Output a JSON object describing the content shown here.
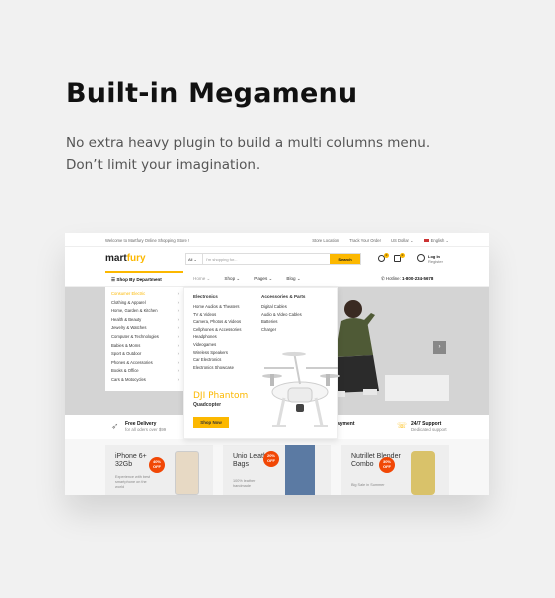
{
  "headline": "Built-in Megamenu",
  "description": [
    "No extra heavy plugin to build a multi columns menu.",
    "Don’t limit your imagination."
  ],
  "screenshot": {
    "topbar": {
      "welcome": "Welcome to Martfury Online Shopping Store !",
      "store_location": "Store Location",
      "track_order": "Track Your Order",
      "currency": "US Dollar ⌄",
      "language": "English ⌄"
    },
    "logo": {
      "part1": "mart",
      "part2": "fury"
    },
    "search": {
      "category": "All ⌄",
      "placeholder": "I'm shopping for...",
      "button": "Search"
    },
    "badges": {
      "wishlist": "0",
      "cart": "0"
    },
    "login": {
      "label": "Log In",
      "sub": "Register"
    },
    "nav": {
      "department": "Shop By Department",
      "links": [
        "Home ⌄",
        "Shop ⌄",
        "Pages ⌄",
        "Blog ⌄"
      ],
      "hotline_label": "Hotline:",
      "hotline_number": "1-800-234-5678"
    },
    "departments": [
      "Consumer Electric",
      "Clothing & Apparel",
      "Home, Garden & Kitchen",
      "Health & Beauty",
      "Jewelry & Watches",
      "Computer & Technologies",
      "Babies & Moms",
      "Sport & Outdoor",
      "Phones & Accessories",
      "Books & Office",
      "Cars & Motocycles"
    ],
    "megamenu": {
      "col1_title": "Electronics",
      "col1_links": [
        "Home Audios & Theaters",
        "TV & Videos",
        "Camera, Photos & Videos",
        "Cellphones & Accessories",
        "Headphones",
        "Videogames",
        "Wireless Speakers",
        "Car Electronics",
        "Electronics Showcase"
      ],
      "col2_title": "Accessories & Parts",
      "col2_links": [
        "Digital Cables",
        "Audio & Video Cables",
        "Batteries",
        "Charger"
      ],
      "promo_title": "DJI Phantom",
      "promo_sub": "Quadcopter",
      "promo_button": "Shop Now"
    },
    "features": [
      {
        "title": "Free Delivery",
        "sub": "for all oders over $99"
      },
      {
        "title": "ayment",
        "sub": ""
      },
      {
        "title": "24/7 Support",
        "sub": "Dedicated support"
      }
    ],
    "promos": [
      {
        "name": "iPhone 6+ 32Gb",
        "note": "Experience with best smartphone on the world",
        "discount": "40% OFF"
      },
      {
        "name": "Unio Leather Bags",
        "note": "100% leather handmade",
        "discount": "20% OFF"
      },
      {
        "name": "Nutrillet Blender Combo",
        "note": "Big Sale in Summer",
        "discount": "30% OFF"
      }
    ],
    "accent_color": "#fcb800"
  }
}
